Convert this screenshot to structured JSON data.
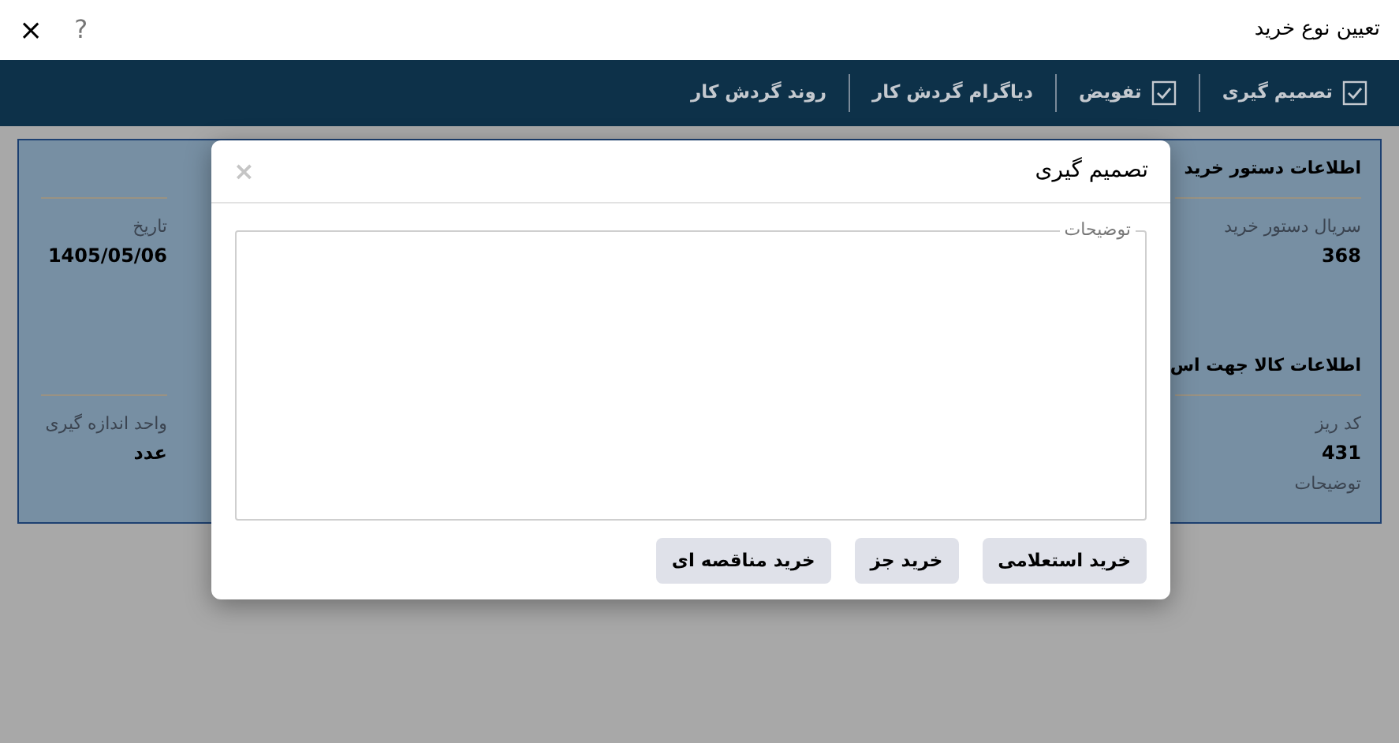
{
  "window": {
    "title": "تعیین نوع خرید",
    "help": "?",
    "close": "×"
  },
  "toolbar": [
    {
      "label": "تصمیم گیری",
      "kind": "check"
    },
    {
      "label": "تفویض",
      "kind": "check"
    },
    {
      "label": "دیاگرام گردش کار",
      "kind": "plain"
    },
    {
      "label": "روند گردش کار",
      "kind": "plain"
    }
  ],
  "sections": [
    {
      "title": "اطلاعات دستور خرید",
      "right": [
        {
          "label": "سریال دستور خرید",
          "value": "368"
        }
      ],
      "left": [
        {
          "label": "تاریخ",
          "value": "1405/05/06"
        }
      ]
    },
    {
      "title": "اطلاعات کالا جهت اس",
      "right": [
        {
          "label": "کد ریز",
          "value": "431"
        },
        {
          "label": "توضیحات"
        }
      ],
      "left": [
        {
          "label": "واحد اندازه گیری",
          "value": "عدد"
        }
      ]
    }
  ],
  "dialog": {
    "title": "تصمیم گیری",
    "close": "×",
    "field": {
      "legend": "توضیحات"
    },
    "buttons": [
      "خرید استعلامی",
      "خرید جز",
      "خرید مناقصه ای"
    ]
  }
}
